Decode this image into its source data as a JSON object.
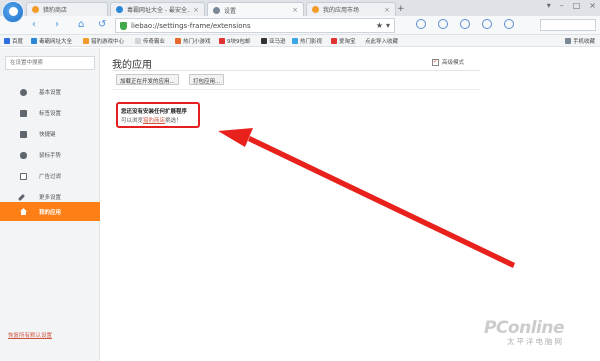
{
  "tabs": [
    {
      "label": "猎豹商店",
      "icon_color": "#f39a2b"
    },
    {
      "label": "毒霸网址大全 - 最安全...",
      "icon_color": "#2a86d6"
    },
    {
      "label": "设置",
      "icon_color": "#7a8794"
    },
    {
      "label": "我的应用市场",
      "icon_color": "#f39a2b"
    }
  ],
  "address_bar": {
    "url": "liebao://settings-frame/extensions"
  },
  "bookmarks": [
    {
      "label": "百度",
      "color": "#2d6ee0"
    },
    {
      "label": "毒霸网址大全",
      "color": "#2a86d6"
    },
    {
      "label": "猎豹游戏中心",
      "color": "#f39a2b"
    },
    {
      "label": "传奇霸业",
      "color": "#cfd4d9"
    },
    {
      "label": "热门小游戏",
      "color": "#e7682b"
    },
    {
      "label": "9块9包邮",
      "color": "#e0322e"
    },
    {
      "label": "亚马逊",
      "color": "#333333"
    },
    {
      "label": "热门影视",
      "color": "#3aa8e8"
    },
    {
      "label": "爱淘宝",
      "color": "#e0322e"
    },
    {
      "label": "点此导入收藏",
      "color": ""
    },
    {
      "label": "手机收藏",
      "color": "#7a8794"
    }
  ],
  "sidebar": {
    "search_placeholder": "在设置中搜索",
    "items": [
      {
        "label": "基本设置",
        "icon": "gear-icon"
      },
      {
        "label": "标签设置",
        "icon": "tab-icon"
      },
      {
        "label": "快捷键",
        "icon": "keyboard-icon"
      },
      {
        "label": "鼠标手势",
        "icon": "mouse-icon"
      },
      {
        "label": "广告过滤",
        "icon": "filter-icon"
      },
      {
        "label": "更多设置",
        "icon": "wrench-icon"
      },
      {
        "label": "我的应用",
        "icon": "home-icon"
      }
    ],
    "active_index": 6,
    "restore_link": "恢复所有默认设置"
  },
  "main": {
    "title": "我的应用",
    "dev_mode_label": "高级模式",
    "buttons": [
      "加载正在开发的应用...",
      "打包应用..."
    ],
    "notice_title": "您还没有安装任何扩展程序",
    "notice_prefix": "可以浏览",
    "notice_link": "猎豹商店",
    "notice_suffix": "挑选！"
  },
  "watermark": {
    "brand": "PConline",
    "sub": "太平洋电脑网"
  },
  "colors": {
    "accent_orange": "#ff7f17",
    "highlight_red": "#e51f1f",
    "link": "#d0553f",
    "nav_blue": "#4a8fd8"
  }
}
